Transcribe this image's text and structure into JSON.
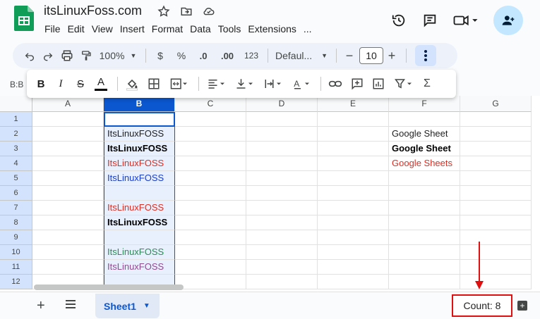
{
  "header": {
    "title": "itsLinuxFoss.com",
    "menu": [
      "File",
      "Edit",
      "View",
      "Insert",
      "Format",
      "Data",
      "Tools",
      "Extensions",
      "..."
    ]
  },
  "toolbar": {
    "zoom": "100%",
    "currency": "$",
    "percent": "%",
    "dec_decrease": ".0",
    "dec_increase": ".00",
    "number_format": "123",
    "font": "Defaul...",
    "font_size": "10",
    "minus": "−",
    "plus": "+"
  },
  "namebox": "B:B",
  "columns": [
    "A",
    "B",
    "C",
    "D",
    "E",
    "F",
    "G"
  ],
  "selected_column": "B",
  "rows": [
    {
      "num": "1",
      "b": "",
      "b_style": "",
      "f": "",
      "f_style": ""
    },
    {
      "num": "2",
      "b": "ItsLinuxFOSS",
      "b_style": "normal",
      "f": "Google Sheet",
      "f_style": "normal"
    },
    {
      "num": "3",
      "b": "ItsLinuxFOSS",
      "b_style": "bold",
      "f": "Google Sheet",
      "f_style": "bold"
    },
    {
      "num": "4",
      "b": "ItsLinuxFOSS",
      "b_style": "red",
      "f": "Google Sheets",
      "f_style": "red"
    },
    {
      "num": "5",
      "b": "ItsLinuxFOSS",
      "b_style": "blue",
      "f": "",
      "f_style": ""
    },
    {
      "num": "6",
      "b": "",
      "b_style": "",
      "f": "",
      "f_style": ""
    },
    {
      "num": "7",
      "b": "ItsLinuxFOSS",
      "b_style": "red",
      "f": "",
      "f_style": ""
    },
    {
      "num": "8",
      "b": "ItsLinuxFOSS",
      "b_style": "bold",
      "f": "",
      "f_style": ""
    },
    {
      "num": "9",
      "b": "",
      "b_style": "",
      "f": "",
      "f_style": ""
    },
    {
      "num": "10",
      "b": "ItsLinuxFOSS",
      "b_style": "green",
      "f": "",
      "f_style": ""
    },
    {
      "num": "11",
      "b": "ItsLinuxFOSS",
      "b_style": "purple",
      "f": "",
      "f_style": ""
    },
    {
      "num": "12",
      "b": "",
      "b_style": "",
      "f": "",
      "f_style": ""
    }
  ],
  "colors": {
    "normal": "#1f1f1f",
    "bold": "#000000",
    "red": "#d93025",
    "blue": "#1a3ec9",
    "green": "#2e8b57",
    "purple": "#8e4b8e",
    "accent": "#0b57d0",
    "highlight": "#e01010"
  },
  "bottom": {
    "sheet_name": "Sheet1",
    "count_label": "Count: 8"
  }
}
